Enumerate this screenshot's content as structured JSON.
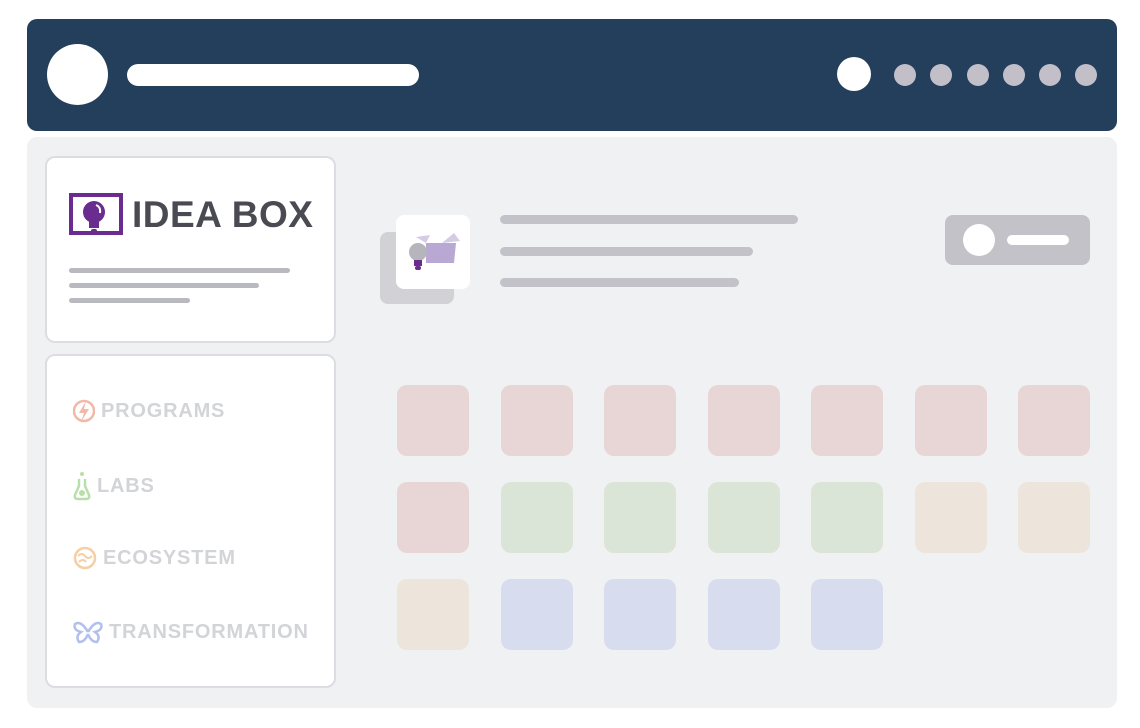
{
  "brand": {
    "name": "IDEA BOX"
  },
  "nav": {
    "items": [
      {
        "label": "PROGRAMS",
        "icon": "lightning-icon",
        "color": "#f2b9a9"
      },
      {
        "label": "LABS",
        "icon": "flask-icon",
        "color": "#b8dfaa"
      },
      {
        "label": "ECOSYSTEM",
        "icon": "globe-icon",
        "color": "#f6cfa4"
      },
      {
        "label": "TRANSFORMATION",
        "icon": "butterfly-icon",
        "color": "#b3c0ec"
      }
    ]
  },
  "colors": {
    "header": "#233f5c",
    "brand_purple": "#6a2c8e",
    "tile_red": "#e8d6d6",
    "tile_green": "#dbe5d7",
    "tile_beige": "#ede5db",
    "tile_blue": "#d8dcef"
  },
  "tiles": {
    "rows": [
      [
        "tile_red",
        "tile_red",
        "tile_red",
        "tile_red",
        "tile_red",
        "tile_red",
        "tile_red"
      ],
      [
        "tile_red",
        "tile_green",
        "tile_green",
        "tile_green",
        "tile_green",
        "tile_beige",
        "tile_beige"
      ],
      [
        "tile_beige",
        "tile_blue",
        "tile_blue",
        "tile_blue",
        "tile_blue"
      ]
    ]
  }
}
